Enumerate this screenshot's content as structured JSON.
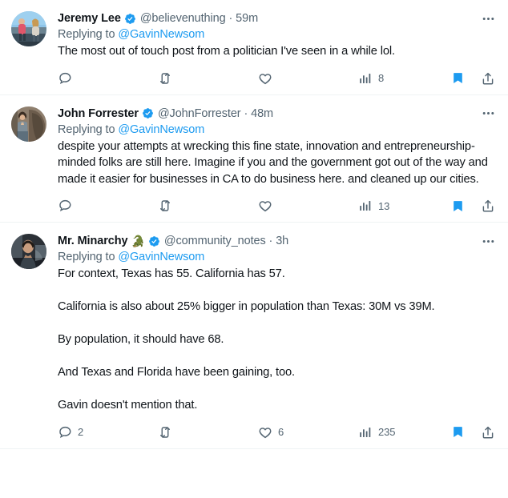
{
  "theme": {
    "background": "#ffffff",
    "text_primary": "#0f1419",
    "text_secondary": "#536471",
    "accent_blue": "#1d9bf0",
    "divider": "#eff3f4"
  },
  "tweets": [
    {
      "display_name": "Jeremy Lee",
      "name_emoji": "",
      "verified": true,
      "handle_time": "@believenuthing · 59m",
      "handle": "@believenuthing",
      "time": "59m",
      "replying_label": "Replying to ",
      "replying_mention": "@GavinNewsom",
      "text": "The most out of touch post from a politician I've seen in a while lol.",
      "actions": {
        "reply_count": "",
        "retweet_count": "",
        "like_count": "",
        "views_count": "8",
        "bookmarked": true
      }
    },
    {
      "display_name": "John Forrester",
      "name_emoji": "",
      "verified": true,
      "handle_time": "@JohnForrester · 48m",
      "handle": "@JohnForrester",
      "time": "48m",
      "replying_label": "Replying to ",
      "replying_mention": "@GavinNewsom",
      "text": "despite your attempts at wrecking this fine state, innovation and entrepreneurship-minded folks are still here. Imagine if you and the government got out of the way and made it easier for businesses in CA to do business here. and cleaned up our cities.",
      "actions": {
        "reply_count": "",
        "retweet_count": "",
        "like_count": "",
        "views_count": "13",
        "bookmarked": true
      }
    },
    {
      "display_name": "Mr. Minarchy",
      "name_emoji": "🐊",
      "verified": true,
      "handle_time": "@community_notes · 3h",
      "handle": "@community_notes",
      "time": "3h",
      "replying_label": "Replying to ",
      "replying_mention": "@GavinNewsom",
      "text": "For context, Texas has 55. California has 57.\n\nCalifornia is also about 25% bigger in population than Texas: 30M vs 39M.\n\nBy population, it should have 68.\n\nAnd Texas and Florida have been gaining, too.\n\nGavin doesn't mention that.",
      "actions": {
        "reply_count": "2",
        "retweet_count": "",
        "like_count": "6",
        "views_count": "235",
        "bookmarked": true
      }
    }
  ],
  "icons": {
    "reply": "reply-icon",
    "retweet": "retweet-icon",
    "like": "like-icon",
    "views": "views-icon",
    "bookmark": "bookmark-icon",
    "share": "share-icon",
    "more": "more-options-icon",
    "verified": "verified-badge-icon"
  }
}
